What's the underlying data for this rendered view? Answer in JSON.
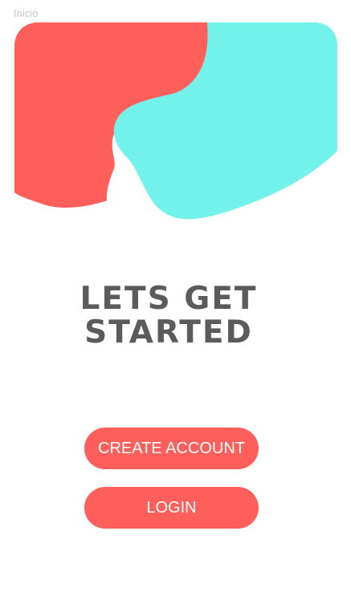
{
  "screen": {
    "label": "Inicio"
  },
  "hero": {
    "colors": {
      "left_shape": "#ff5f5a",
      "right_shape": "#73f2eb"
    }
  },
  "headline": {
    "line1": "LETS GET",
    "line2": "STARTED"
  },
  "actions": {
    "create_account_label": "CREATE ACCOUNT",
    "login_label": "LOGIN"
  },
  "theme": {
    "accent": "#ff5f5a",
    "headline_color": "#5b5b5b",
    "button_text_color": "#ffffff"
  }
}
